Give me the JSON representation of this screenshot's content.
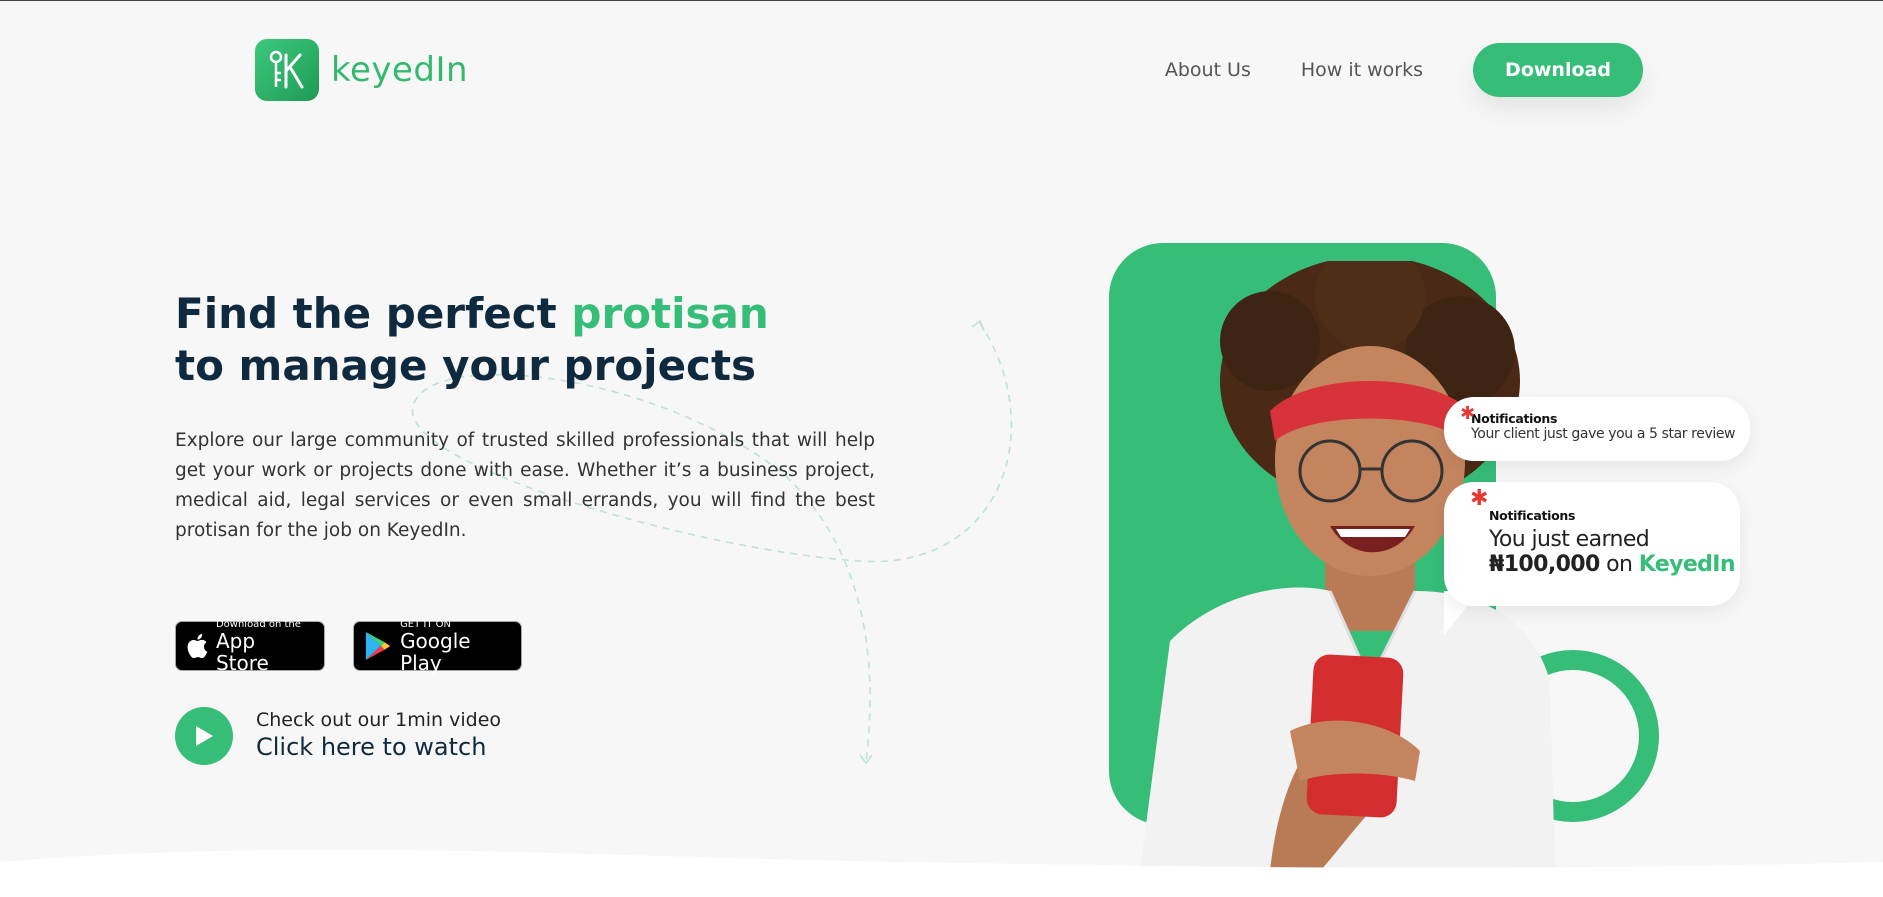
{
  "brand": {
    "name": "keyedIn",
    "accent": "#36bd78",
    "dark": "#0f2a3f"
  },
  "nav": {
    "about": "About Us",
    "how": "How it works",
    "download": "Download"
  },
  "hero": {
    "title_part1": "Find the perfect ",
    "title_accent": "protisan",
    "title_part2": "to manage your projects",
    "description": "Explore our large community of trusted skilled professionals that will help get your work or projects done with ease. Whether it’s a business project, medical aid, legal services or even small errands, you will find the best protisan for the job on KeyedIn."
  },
  "stores": {
    "appstore_small": "Download on the",
    "appstore_big": "App Store",
    "play_small": "GET IT ON",
    "play_big": "Google Play"
  },
  "video": {
    "sub": "Check out our 1min video",
    "main": "Click here to watch"
  },
  "notifications": [
    {
      "title": "Notifications",
      "text": "Your client just gave you a 5 star review"
    },
    {
      "title": "Notifications",
      "text_line1": "You just earned",
      "amount": "₦100,000",
      "on": " on ",
      "brand": "KeyedIn"
    }
  ]
}
